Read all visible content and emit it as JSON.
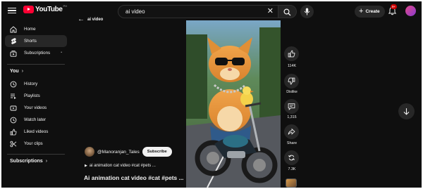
{
  "header": {
    "logo_text": "YouTube",
    "logo_sup": "PH",
    "search": {
      "value": "ai video",
      "clear": "✕"
    },
    "create_label": "Create",
    "create_plus": "+",
    "notification_count": "9+"
  },
  "sidebar": {
    "primary": [
      {
        "label": "Home",
        "icon": "home-icon"
      },
      {
        "label": "Shorts",
        "icon": "shorts-icon",
        "active": true
      },
      {
        "label": "Subscriptions",
        "icon": "subscriptions-icon",
        "caret": "•"
      }
    ],
    "you_heading": "You",
    "you_chevron": "›",
    "you_items": [
      {
        "label": "History",
        "icon": "history-icon"
      },
      {
        "label": "Playlists",
        "icon": "playlists-icon"
      },
      {
        "label": "Your videos",
        "icon": "your-videos-icon"
      },
      {
        "label": "Watch later",
        "icon": "watch-later-icon"
      },
      {
        "label": "Liked videos",
        "icon": "liked-videos-icon"
      },
      {
        "label": "Your clips",
        "icon": "clips-icon"
      }
    ],
    "subs_heading": "Subscriptions",
    "subs_chevron": "›"
  },
  "main": {
    "back_arrow": "←",
    "back_label": "ai video",
    "channel_name": "@Manoranjan_Tales",
    "subscribe_label": "Subscribe",
    "description_play": "▶",
    "description": "ai animation cat video #cat #pets ...",
    "title": "Ai animation cat video #cat #pets ..."
  },
  "actions": {
    "like_count": "114K",
    "dislike_label": "Dislike",
    "comment_count": "1,315",
    "share_label": "Share",
    "remix_count": "7.3K"
  },
  "colors": {
    "background": "#0f0f0f",
    "surface": "#272727",
    "brand_red": "#ff0033",
    "text": "#f1f1f1"
  }
}
